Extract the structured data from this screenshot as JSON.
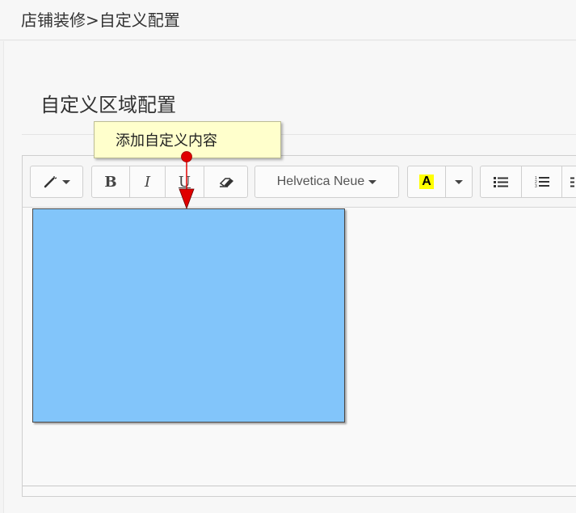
{
  "header": {
    "breadcrumb": "店铺装修>自定义配置"
  },
  "section": {
    "title": "自定义区域配置"
  },
  "callout": {
    "text": "添加自定义内容"
  },
  "toolbar": {
    "style_button_icon": "magic-wand-icon",
    "bold_label": "B",
    "italic_label": "I",
    "underline_label": "U",
    "eraser_icon": "eraser-icon",
    "font_family": "Helvetica Neue",
    "highlight_label": "A",
    "highlight_color": "#ffff00",
    "unordered_list_icon": "unordered-list-icon",
    "ordered_list_icon": "ordered-list-icon",
    "indent_icon": "list-icon"
  },
  "colors": {
    "accent_blue": "#82c5fa",
    "callout_bg": "#ffffcc",
    "callout_arrow": "#e00000"
  }
}
